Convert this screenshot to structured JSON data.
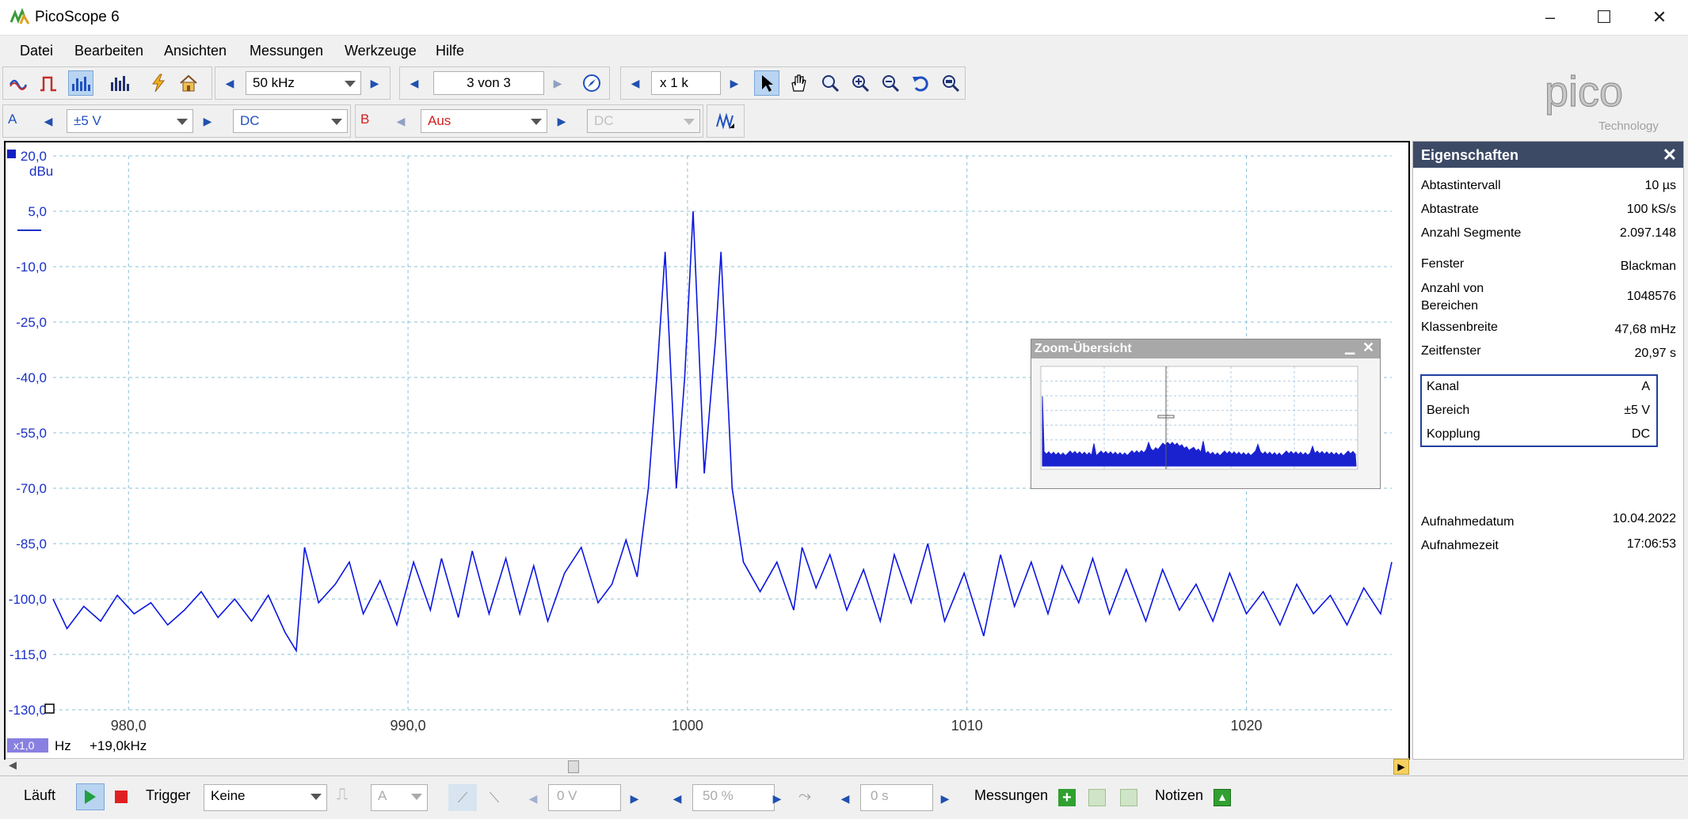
{
  "window": {
    "title": "PicoScope 6",
    "controls": {
      "minimize": "–",
      "maximize": "☐",
      "close": "✕"
    }
  },
  "menu": [
    "Datei",
    "Bearbeiten",
    "Ansichten",
    "Messungen",
    "Werkzeuge",
    "Hilfe"
  ],
  "toolbar": {
    "timebase": "50 kHz",
    "buffer": "3 von 3",
    "zoom": "x 1 k"
  },
  "channels": {
    "a": {
      "label": "A",
      "range": "±5 V",
      "coupling": "DC"
    },
    "b": {
      "label": "B",
      "range": "Aus",
      "coupling": "DC"
    }
  },
  "logo": {
    "brand": "pico",
    "sub": "Technology"
  },
  "plot": {
    "y_unit": "dBu",
    "x_unit": "Hz",
    "x_scale_badge": "x1,0",
    "x_offset": "+19,0kHz",
    "colors": {
      "trace": "#0a16e0",
      "grid": "#8ac0d6",
      "axis_text": "#1a30c8"
    }
  },
  "chart_data": {
    "type": "line",
    "title": "",
    "xlabel": "Hz",
    "ylabel": "dBu",
    "xlim": [
      977.3,
      1025.2
    ],
    "ylim": [
      -130,
      20
    ],
    "x_tick_labels": [
      "980,0",
      "990,0",
      "1000",
      "1010",
      "1020"
    ],
    "y_tick_labels": [
      "20,0",
      "5,0",
      "-10,0",
      "-25,0",
      "-40,0",
      "-55,0",
      "-70,0",
      "-85,0",
      "-100,0",
      "-115,0",
      "-130,0"
    ],
    "series": [
      {
        "values": [
          [
            977.3,
            -100
          ],
          [
            977.8,
            -108
          ],
          [
            978.4,
            -102
          ],
          [
            979.0,
            -106
          ],
          [
            979.6,
            -99
          ],
          [
            980.2,
            -104
          ],
          [
            980.8,
            -101
          ],
          [
            981.4,
            -107
          ],
          [
            982.0,
            -103
          ],
          [
            982.6,
            -98
          ],
          [
            983.2,
            -105
          ],
          [
            983.8,
            -100
          ],
          [
            984.4,
            -106
          ],
          [
            985.0,
            -99
          ],
          [
            985.6,
            -109
          ],
          [
            986.0,
            -114
          ],
          [
            986.3,
            -86
          ],
          [
            986.8,
            -101
          ],
          [
            987.4,
            -96
          ],
          [
            987.9,
            -90
          ],
          [
            988.4,
            -104
          ],
          [
            989.0,
            -95
          ],
          [
            989.6,
            -107
          ],
          [
            990.2,
            -90
          ],
          [
            990.8,
            -103
          ],
          [
            991.2,
            -89
          ],
          [
            991.8,
            -105
          ],
          [
            992.3,
            -87
          ],
          [
            992.9,
            -104
          ],
          [
            993.5,
            -89
          ],
          [
            994.0,
            -104
          ],
          [
            994.5,
            -91
          ],
          [
            995.0,
            -106
          ],
          [
            995.6,
            -93
          ],
          [
            996.2,
            -86
          ],
          [
            996.8,
            -101
          ],
          [
            997.3,
            -96
          ],
          [
            997.8,
            -84
          ],
          [
            998.2,
            -94
          ],
          [
            998.6,
            -70
          ],
          [
            998.9,
            -40
          ],
          [
            999.2,
            -6
          ],
          [
            999.6,
            -70
          ],
          [
            999.9,
            -40
          ],
          [
            1000.2,
            5
          ],
          [
            1000.6,
            -66
          ],
          [
            1001.0,
            -30
          ],
          [
            1001.2,
            -6
          ],
          [
            1001.6,
            -70
          ],
          [
            1002.0,
            -90
          ],
          [
            1002.6,
            -98
          ],
          [
            1003.2,
            -90
          ],
          [
            1003.8,
            -103
          ],
          [
            1004.1,
            -86
          ],
          [
            1004.6,
            -97
          ],
          [
            1005.1,
            -88
          ],
          [
            1005.7,
            -103
          ],
          [
            1006.3,
            -92
          ],
          [
            1006.9,
            -106
          ],
          [
            1007.4,
            -88
          ],
          [
            1008.0,
            -101
          ],
          [
            1008.6,
            -85
          ],
          [
            1009.2,
            -106
          ],
          [
            1009.9,
            -93
          ],
          [
            1010.6,
            -110
          ],
          [
            1011.2,
            -88
          ],
          [
            1011.7,
            -102
          ],
          [
            1012.3,
            -90
          ],
          [
            1012.9,
            -104
          ],
          [
            1013.4,
            -91
          ],
          [
            1014.0,
            -101
          ],
          [
            1014.5,
            -89
          ],
          [
            1015.1,
            -104
          ],
          [
            1015.7,
            -92
          ],
          [
            1016.4,
            -106
          ],
          [
            1017.0,
            -92
          ],
          [
            1017.6,
            -103
          ],
          [
            1018.2,
            -96
          ],
          [
            1018.8,
            -106
          ],
          [
            1019.4,
            -93
          ],
          [
            1020.0,
            -104
          ],
          [
            1020.6,
            -98
          ],
          [
            1021.2,
            -107
          ],
          [
            1021.8,
            -96
          ],
          [
            1022.4,
            -104
          ],
          [
            1023.0,
            -99
          ],
          [
            1023.6,
            -107
          ],
          [
            1024.2,
            -97
          ],
          [
            1024.8,
            -104
          ],
          [
            1025.2,
            -90
          ]
        ]
      }
    ],
    "grid": true
  },
  "zoom_overview": {
    "title": "Zoom-Übersicht"
  },
  "properties": {
    "title": "Eigenschaften",
    "rows": [
      {
        "label": "Abtastintervall",
        "value": "10 µs"
      },
      {
        "label": "Abtastrate",
        "value": "100 kS/s"
      },
      {
        "label": "Anzahl Segmente",
        "value": "2.097.148"
      },
      {
        "label": "Fenster",
        "value": "Blackman"
      },
      {
        "label": "Anzahl von Bereichen",
        "value": "1048576"
      },
      {
        "label": "Klassenbreite",
        "value": "47,68 mHz"
      },
      {
        "label": "Zeitfenster",
        "value": "20,97 s"
      }
    ],
    "channel_box": [
      {
        "label": "Kanal",
        "value": "A"
      },
      {
        "label": "Bereich",
        "value": "±5 V"
      },
      {
        "label": "Kopplung",
        "value": "DC"
      }
    ],
    "capture": [
      {
        "label": "Aufnahmedatum",
        "value": "10.04.2022"
      },
      {
        "label": "Aufnahmezeit",
        "value": "17:06:53"
      }
    ]
  },
  "statusbar": {
    "run_label": "Läuft",
    "trigger_label": "Trigger",
    "trigger_mode": "Keine",
    "trigger_channel": "A",
    "trigger_level": "0 V",
    "pretrigger": "50 %",
    "delay": "0 s",
    "measurements_label": "Messungen",
    "notes_label": "Notizen"
  }
}
